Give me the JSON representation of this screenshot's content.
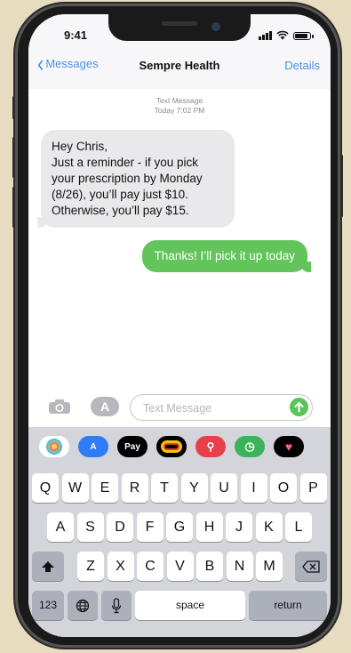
{
  "status_bar": {
    "time": "9:41"
  },
  "nav": {
    "back_label": "Messages",
    "title": "Sempre Health",
    "details_label": "Details"
  },
  "thread": {
    "stamp_line1": "Text Message",
    "stamp_line2": "Today 7:02 PM",
    "incoming": [
      "Hey Chris,",
      "Just a reminder - if you pick",
      "your prescription by Monday",
      "(8/26), you’ll pay just $10.",
      "Otherwise, you’ll pay $15."
    ],
    "outgoing": "Thanks! I’ll pick it up today"
  },
  "composer": {
    "placeholder": "Text Message",
    "apps_label": "A"
  },
  "app_strip": [
    {
      "name": "photos-app-icon",
      "color": "#ffffff"
    },
    {
      "name": "app-store-icon",
      "color": "#2f7cf6"
    },
    {
      "name": "apple-pay-icon",
      "color": "#000000",
      "label": "Pay"
    },
    {
      "name": "activity-rings-icon",
      "color": "#000000"
    },
    {
      "name": "search-images-icon",
      "color": "#e5404b"
    },
    {
      "name": "music-clock-icon",
      "color": "#3cb35b"
    },
    {
      "name": "heart-app-icon",
      "color": "#000000"
    }
  ],
  "keyboard": {
    "row1": [
      "Q",
      "W",
      "E",
      "R",
      "T",
      "Y",
      "U",
      "I",
      "O",
      "P"
    ],
    "row2": [
      "A",
      "S",
      "D",
      "F",
      "G",
      "H",
      "J",
      "K",
      "L"
    ],
    "row3": [
      "Z",
      "X",
      "C",
      "V",
      "B",
      "N",
      "M"
    ],
    "numbers_label": "123",
    "space_label": "space",
    "return_label": "return"
  },
  "colors": {
    "ios_blue": "#4a90e2",
    "bubble_green": "#62c45b",
    "bubble_gray": "#e9e9eb"
  }
}
